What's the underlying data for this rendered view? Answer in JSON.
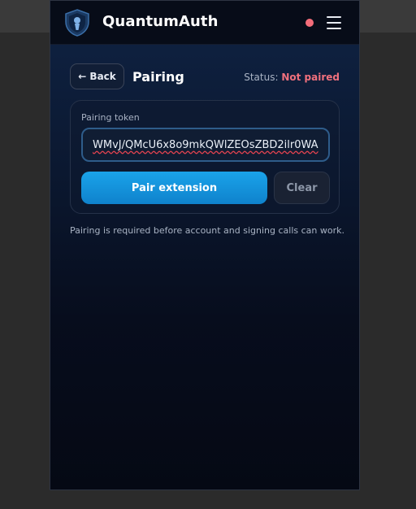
{
  "header": {
    "app_title": "QuantumAuth",
    "status_dot_color": "#f36d7a",
    "logo_icon": "shield-logo-icon",
    "menu_icon": "hamburger-menu-icon"
  },
  "page": {
    "back_label": "← Back",
    "title": "Pairing",
    "status_label": "Status:",
    "status_value": "Not paired",
    "status_color": "#f0707d"
  },
  "form": {
    "token_label": "Pairing token",
    "token_value": "WMvJ/QMcU6x8o9mkQWlZEOsZBD2ilr0WA",
    "pair_button": "Pair extension",
    "clear_button": "Clear"
  },
  "hint": "Pairing is required before account and signing calls can work.",
  "colors": {
    "accent": "#1aa3ea",
    "background": "#070d1d"
  }
}
